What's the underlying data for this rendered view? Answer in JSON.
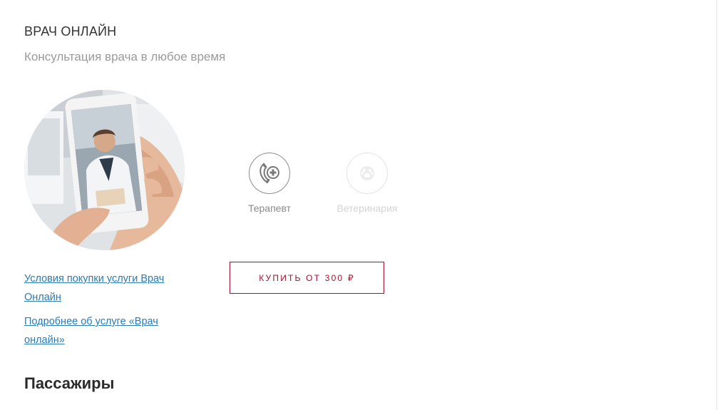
{
  "service": {
    "title": "ВРАЧ ОНЛАЙН",
    "subtitle": "Консультация врача в любое время"
  },
  "photo": {
    "description_icon": "doctor-video-call-photo"
  },
  "consultation_types": [
    {
      "label": "Терапевт",
      "icon": "phone-medical-cross-icon",
      "active": true
    },
    {
      "label": "Ветеринария",
      "icon": "paw-icon",
      "active": false
    }
  ],
  "links": [
    {
      "label": "Условия покупки услуги Врач Онлайн"
    },
    {
      "label": "Подробнее об услуге «Врач онлайн»"
    }
  ],
  "buy_button": {
    "label": "КУПИТЬ ОТ 300 ₽"
  },
  "next_section": {
    "title": "Пассажиры"
  },
  "colors": {
    "accent": "#a3102e",
    "link": "#2b7bb9",
    "muted_text": "#9a9a9a"
  }
}
